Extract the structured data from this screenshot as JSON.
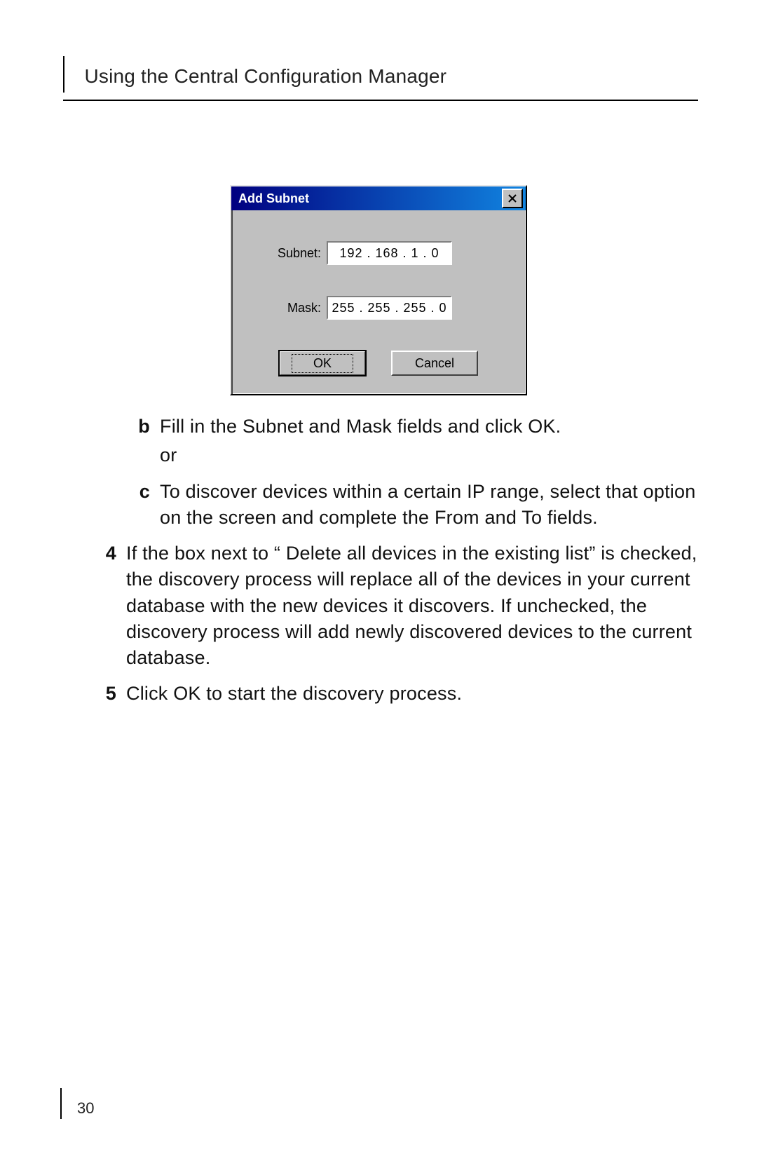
{
  "header": {
    "title": "Using the Central Configuration Manager"
  },
  "dialog": {
    "title": "Add Subnet",
    "subnet_label": "Subnet:",
    "subnet_value": "192 . 168 .  1  .  0",
    "mask_label": "Mask:",
    "mask_value": "255 . 255 . 255 .  0",
    "ok_label": "OK",
    "cancel_label": "Cancel"
  },
  "steps": {
    "b_marker": "b",
    "b_text": "Fill in the Subnet and Mask fields and click OK.",
    "b_or": "or",
    "c_marker": "c",
    "c_text": "To discover devices within a certain IP range, select that option on the screen and complete the From and To fields.",
    "four_marker": "4",
    "four_text": "If the box next to “ Delete all devices in the existing list” is checked, the discovery process will replace all of the devices in your current database with the new devices it discovers. If unchecked, the discovery process will add newly discovered devices to the current database.",
    "five_marker": "5",
    "five_text": "Click OK to start the discovery process."
  },
  "footer": {
    "page_number": "30"
  }
}
